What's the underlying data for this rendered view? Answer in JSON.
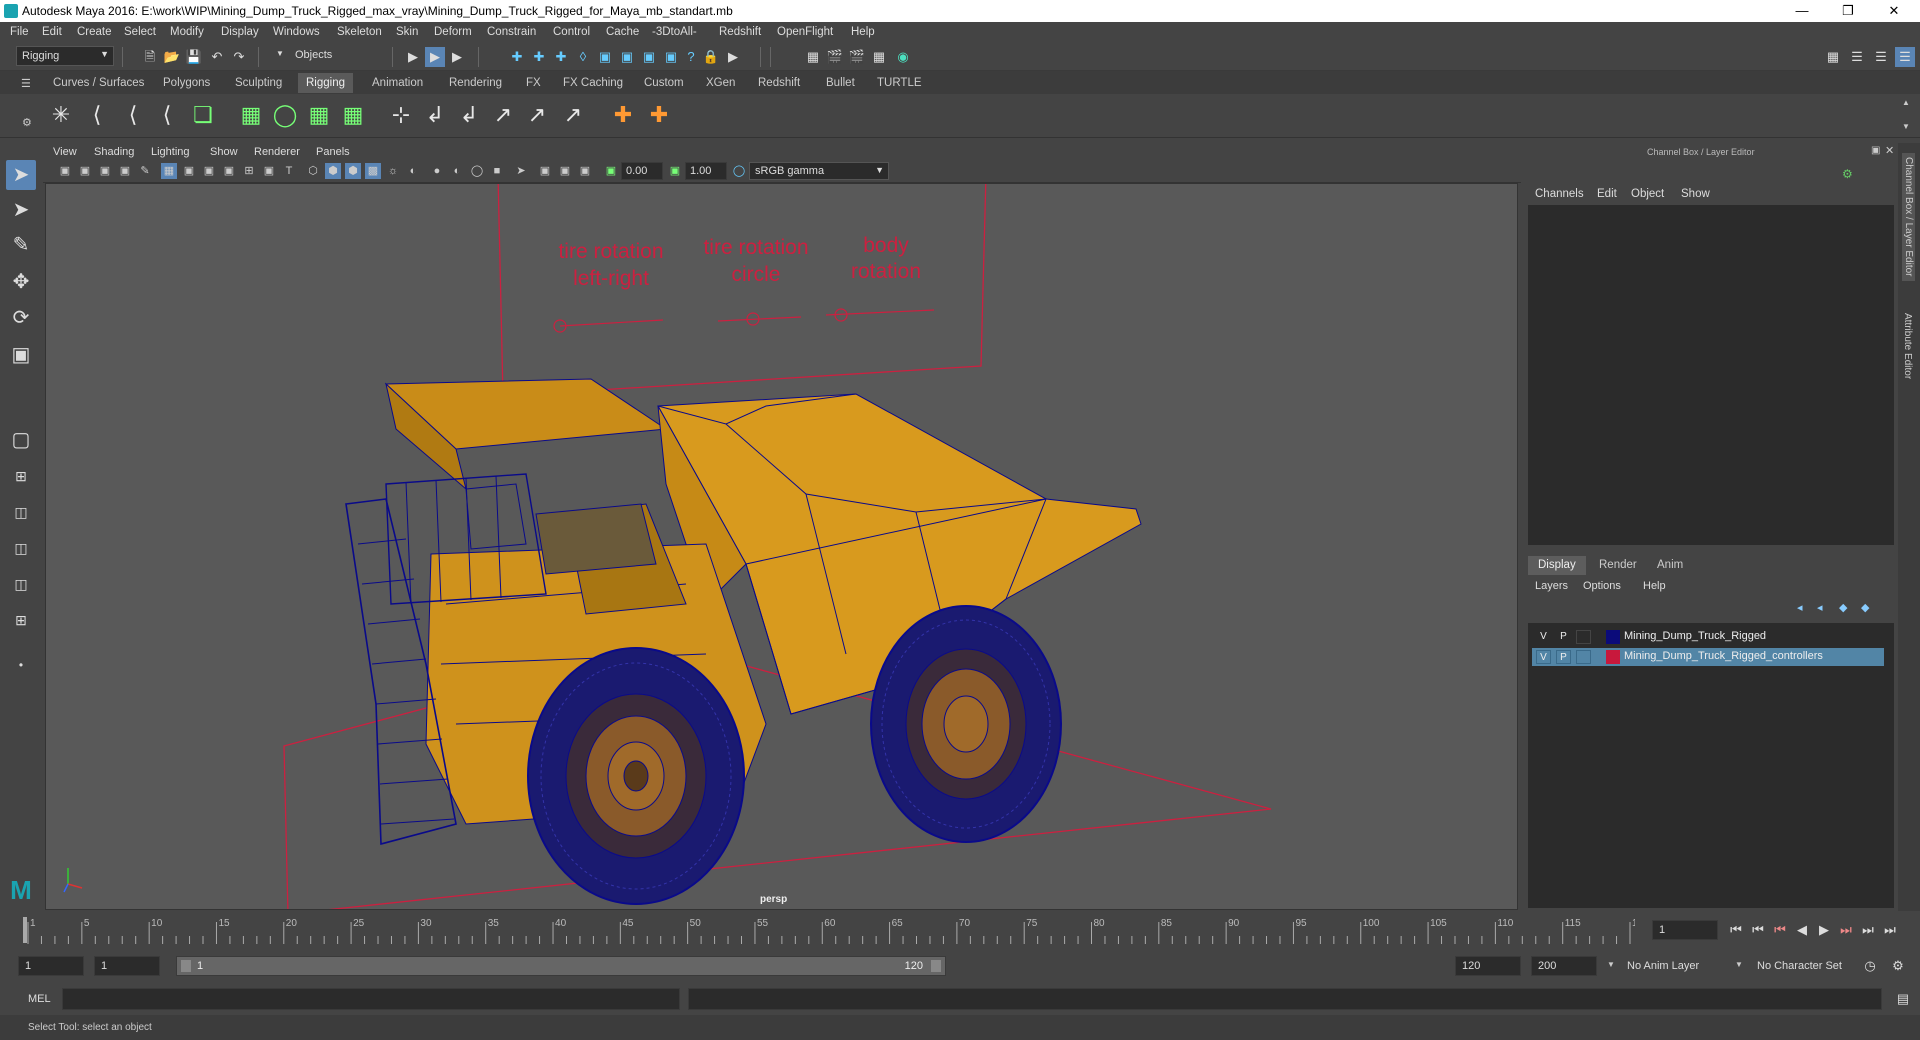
{
  "window": {
    "title": "Autodesk Maya 2016: E:\\work\\WIP\\Mining_Dump_Truck_Rigged_max_vray\\Mining_Dump_Truck_Rigged_for_Maya_mb_standart.mb"
  },
  "menubar": [
    "File",
    "Edit",
    "Create",
    "Select",
    "Modify",
    "Display",
    "Windows",
    "Skeleton",
    "Skin",
    "Deform",
    "Constrain",
    "Control",
    "Cache",
    "-3DtoAll-",
    "Redshift",
    "OpenFlight",
    "Help"
  ],
  "statusline": {
    "menuset": "Rigging",
    "selection_mode": "Objects"
  },
  "shelf_tabs": [
    "Curves / Surfaces",
    "Polygons",
    "Sculpting",
    "Rigging",
    "Animation",
    "Rendering",
    "FX",
    "FX Caching",
    "Custom",
    "XGen",
    "Redshift",
    "Bullet",
    "TURTLE"
  ],
  "active_shelf_tab": "Rigging",
  "panel_menu": [
    "View",
    "Shading",
    "Lighting",
    "Show",
    "Renderer",
    "Panels"
  ],
  "panel_tools": {
    "exposure": "0.00",
    "gamma": "1.00",
    "color_space": "sRGB gamma"
  },
  "viewport": {
    "camera_label": "persp",
    "controller_labels": [
      {
        "line1": "tire rotation",
        "line2": "left-right"
      },
      {
        "line1": "tire rotation",
        "line2": "circle"
      },
      {
        "line1": "body",
        "line2": "rotation"
      }
    ],
    "colors": {
      "wire": "#0a0a8a",
      "body": "#d89a1e",
      "controller": "#cc2040",
      "background": "#595959"
    }
  },
  "channel_box": {
    "header": "Channel Box / Layer Editor",
    "menu": [
      "Channels",
      "Edit",
      "Object",
      "Show"
    ]
  },
  "layer_editor": {
    "tabs": [
      "Display",
      "Render",
      "Anim"
    ],
    "active_tab": "Display",
    "menu": [
      "Layers",
      "Options",
      "Help"
    ],
    "layers": [
      {
        "v": "V",
        "p": "P",
        "color": "#0b0b7a",
        "name": "Mining_Dump_Truck_Rigged",
        "selected": false
      },
      {
        "v": "V",
        "p": "P",
        "color": "#c8183c",
        "name": "Mining_Dump_Truck_Rigged_controllers",
        "selected": true
      }
    ]
  },
  "side_tabs": [
    "Channel Box / Layer Editor",
    "Attribute Editor"
  ],
  "timeslider": {
    "ticks": [
      "1",
      "5",
      "10",
      "15",
      "20",
      "25",
      "30",
      "35",
      "40",
      "45",
      "50",
      "55",
      "60",
      "65",
      "70",
      "75",
      "80",
      "85",
      "90",
      "95",
      "100",
      "105",
      "110",
      "115",
      "120"
    ],
    "current_frame": "1"
  },
  "range": {
    "start": "1",
    "playback_start": "1",
    "slider_start": "1",
    "slider_end": "120",
    "playback_end": "120",
    "end": "200",
    "anim_layer": "No Anim Layer",
    "character_set": "No Character Set"
  },
  "cmdline": {
    "label": "MEL"
  },
  "helpline": {
    "text": "Select Tool: select an object"
  }
}
